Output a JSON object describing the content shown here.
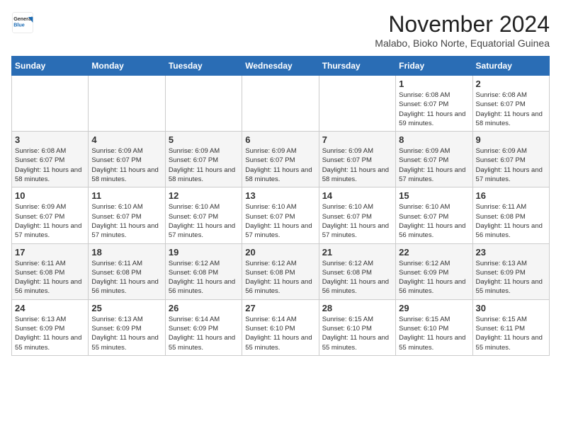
{
  "header": {
    "logo_general": "General",
    "logo_blue": "Blue",
    "month_title": "November 2024",
    "subtitle": "Malabo, Bioko Norte, Equatorial Guinea"
  },
  "weekdays": [
    "Sunday",
    "Monday",
    "Tuesday",
    "Wednesday",
    "Thursday",
    "Friday",
    "Saturday"
  ],
  "weeks": [
    [
      {
        "day": "",
        "info": ""
      },
      {
        "day": "",
        "info": ""
      },
      {
        "day": "",
        "info": ""
      },
      {
        "day": "",
        "info": ""
      },
      {
        "day": "",
        "info": ""
      },
      {
        "day": "1",
        "info": "Sunrise: 6:08 AM\nSunset: 6:07 PM\nDaylight: 11 hours and 59 minutes."
      },
      {
        "day": "2",
        "info": "Sunrise: 6:08 AM\nSunset: 6:07 PM\nDaylight: 11 hours and 58 minutes."
      }
    ],
    [
      {
        "day": "3",
        "info": "Sunrise: 6:08 AM\nSunset: 6:07 PM\nDaylight: 11 hours and 58 minutes."
      },
      {
        "day": "4",
        "info": "Sunrise: 6:09 AM\nSunset: 6:07 PM\nDaylight: 11 hours and 58 minutes."
      },
      {
        "day": "5",
        "info": "Sunrise: 6:09 AM\nSunset: 6:07 PM\nDaylight: 11 hours and 58 minutes."
      },
      {
        "day": "6",
        "info": "Sunrise: 6:09 AM\nSunset: 6:07 PM\nDaylight: 11 hours and 58 minutes."
      },
      {
        "day": "7",
        "info": "Sunrise: 6:09 AM\nSunset: 6:07 PM\nDaylight: 11 hours and 58 minutes."
      },
      {
        "day": "8",
        "info": "Sunrise: 6:09 AM\nSunset: 6:07 PM\nDaylight: 11 hours and 57 minutes."
      },
      {
        "day": "9",
        "info": "Sunrise: 6:09 AM\nSunset: 6:07 PM\nDaylight: 11 hours and 57 minutes."
      }
    ],
    [
      {
        "day": "10",
        "info": "Sunrise: 6:09 AM\nSunset: 6:07 PM\nDaylight: 11 hours and 57 minutes."
      },
      {
        "day": "11",
        "info": "Sunrise: 6:10 AM\nSunset: 6:07 PM\nDaylight: 11 hours and 57 minutes."
      },
      {
        "day": "12",
        "info": "Sunrise: 6:10 AM\nSunset: 6:07 PM\nDaylight: 11 hours and 57 minutes."
      },
      {
        "day": "13",
        "info": "Sunrise: 6:10 AM\nSunset: 6:07 PM\nDaylight: 11 hours and 57 minutes."
      },
      {
        "day": "14",
        "info": "Sunrise: 6:10 AM\nSunset: 6:07 PM\nDaylight: 11 hours and 57 minutes."
      },
      {
        "day": "15",
        "info": "Sunrise: 6:10 AM\nSunset: 6:07 PM\nDaylight: 11 hours and 56 minutes."
      },
      {
        "day": "16",
        "info": "Sunrise: 6:11 AM\nSunset: 6:08 PM\nDaylight: 11 hours and 56 minutes."
      }
    ],
    [
      {
        "day": "17",
        "info": "Sunrise: 6:11 AM\nSunset: 6:08 PM\nDaylight: 11 hours and 56 minutes."
      },
      {
        "day": "18",
        "info": "Sunrise: 6:11 AM\nSunset: 6:08 PM\nDaylight: 11 hours and 56 minutes."
      },
      {
        "day": "19",
        "info": "Sunrise: 6:12 AM\nSunset: 6:08 PM\nDaylight: 11 hours and 56 minutes."
      },
      {
        "day": "20",
        "info": "Sunrise: 6:12 AM\nSunset: 6:08 PM\nDaylight: 11 hours and 56 minutes."
      },
      {
        "day": "21",
        "info": "Sunrise: 6:12 AM\nSunset: 6:08 PM\nDaylight: 11 hours and 56 minutes."
      },
      {
        "day": "22",
        "info": "Sunrise: 6:12 AM\nSunset: 6:09 PM\nDaylight: 11 hours and 56 minutes."
      },
      {
        "day": "23",
        "info": "Sunrise: 6:13 AM\nSunset: 6:09 PM\nDaylight: 11 hours and 55 minutes."
      }
    ],
    [
      {
        "day": "24",
        "info": "Sunrise: 6:13 AM\nSunset: 6:09 PM\nDaylight: 11 hours and 55 minutes."
      },
      {
        "day": "25",
        "info": "Sunrise: 6:13 AM\nSunset: 6:09 PM\nDaylight: 11 hours and 55 minutes."
      },
      {
        "day": "26",
        "info": "Sunrise: 6:14 AM\nSunset: 6:09 PM\nDaylight: 11 hours and 55 minutes."
      },
      {
        "day": "27",
        "info": "Sunrise: 6:14 AM\nSunset: 6:10 PM\nDaylight: 11 hours and 55 minutes."
      },
      {
        "day": "28",
        "info": "Sunrise: 6:15 AM\nSunset: 6:10 PM\nDaylight: 11 hours and 55 minutes."
      },
      {
        "day": "29",
        "info": "Sunrise: 6:15 AM\nSunset: 6:10 PM\nDaylight: 11 hours and 55 minutes."
      },
      {
        "day": "30",
        "info": "Sunrise: 6:15 AM\nSunset: 6:11 PM\nDaylight: 11 hours and 55 minutes."
      }
    ]
  ]
}
